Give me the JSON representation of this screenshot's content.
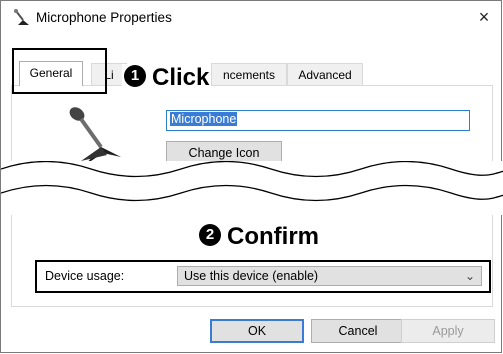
{
  "window": {
    "title": "Microphone Properties",
    "close_glyph": "×"
  },
  "tabs": [
    {
      "label": "General",
      "active": true
    },
    {
      "label": "Li",
      "active": false
    },
    {
      "label": "ncements",
      "active": false
    },
    {
      "label": "Advanced",
      "active": false
    }
  ],
  "general": {
    "device_name": "Microphone",
    "change_icon_label": "Change Icon",
    "change_icon_mnemonic": "I"
  },
  "device_usage": {
    "label": "Device usage:",
    "selected": "Use this device (enable)"
  },
  "buttons": {
    "ok": "OK",
    "cancel": "Cancel",
    "apply": "Apply"
  },
  "annotations": {
    "step1_number": "1",
    "step1_text": "Click",
    "step2_number": "2",
    "step2_text": "Confirm"
  }
}
